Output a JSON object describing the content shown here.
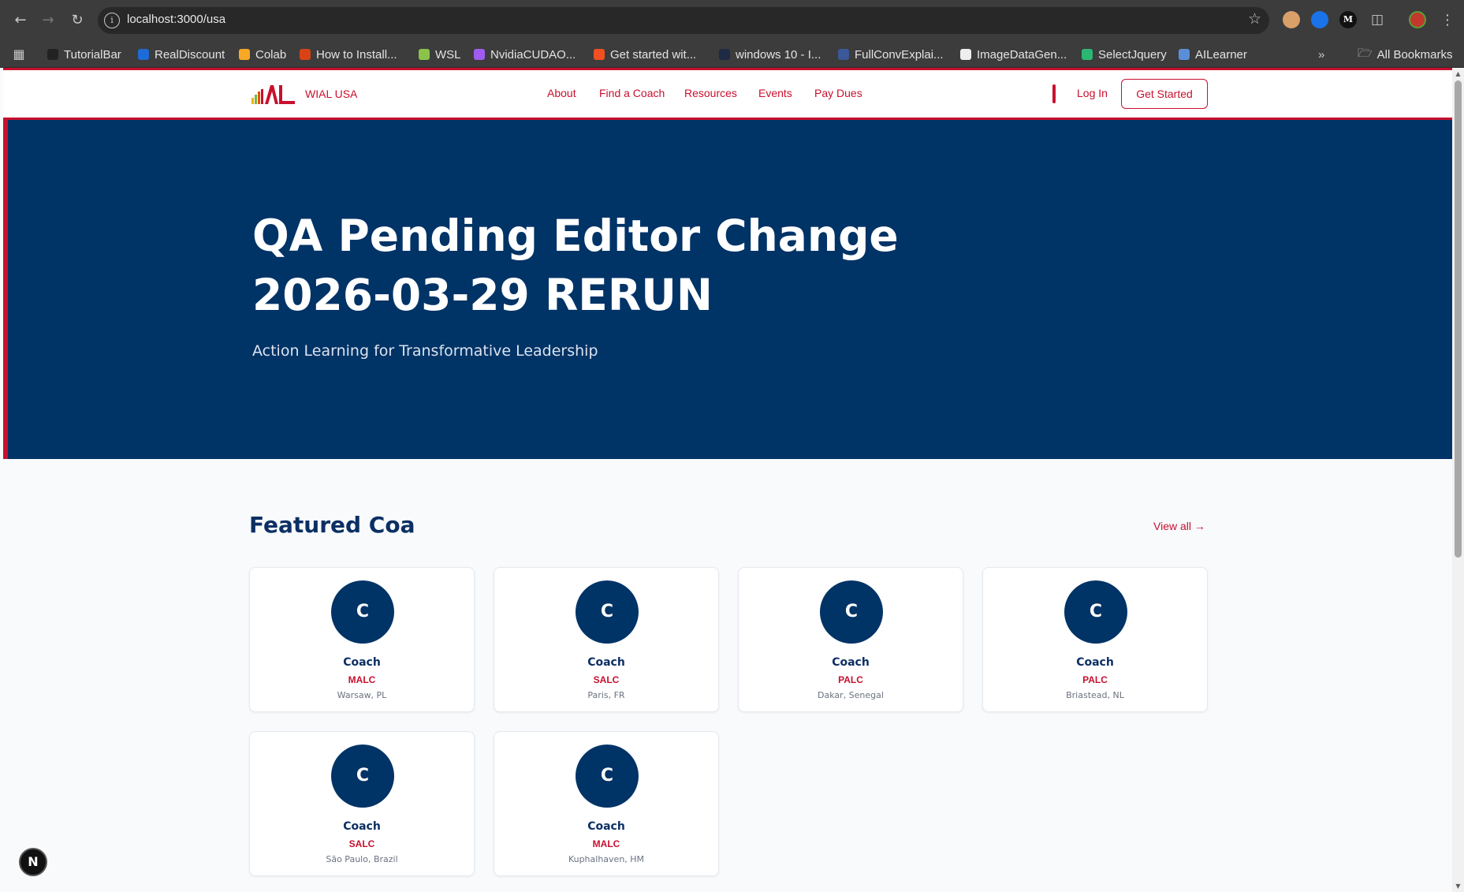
{
  "browser": {
    "url": "localhost:3000/usa",
    "bookmarks": [
      {
        "label": "TutorialBar",
        "color": "#222222"
      },
      {
        "label": "RealDiscount",
        "color": "#1e6ad6"
      },
      {
        "label": "Colab",
        "color": "#f9a825"
      },
      {
        "label": "How to Install...",
        "color": "#d84315"
      },
      {
        "label": "WSL",
        "color": "#8bc34a"
      },
      {
        "label": "NvidiaCUDAO...",
        "color": "#a05cf0"
      },
      {
        "label": "Get started wit...",
        "color": "#f25022"
      },
      {
        "label": "windows 10 - I...",
        "color": "#1f2a44"
      },
      {
        "label": "FullConvExplai...",
        "color": "#3b5998"
      },
      {
        "label": "ImageDataGen...",
        "color": "#eeeeee"
      },
      {
        "label": "SelectJquery",
        "color": "#2bb673"
      },
      {
        "label": "AILearner",
        "color": "#5a8fd8"
      }
    ],
    "all_bookmarks_label": "All Bookmarks"
  },
  "site": {
    "brand": "WIAL USA",
    "nav": [
      "About",
      "Find a Coach",
      "Resources",
      "Events",
      "Pay Dues"
    ],
    "login": "Log In",
    "cta": "Get Started"
  },
  "hero": {
    "title": "QA Pending Editor Change 2026-03-29 RERUN",
    "subtitle": "Action Learning for Transformative Leadership"
  },
  "featured": {
    "title": "Featured Coa",
    "view_all": "View all →",
    "coaches": [
      {
        "initial": "C",
        "name": "Coach",
        "cert": "MALC",
        "location": "Warsaw, PL"
      },
      {
        "initial": "C",
        "name": "Coach",
        "cert": "SALC",
        "location": "Paris, FR"
      },
      {
        "initial": "C",
        "name": "Coach",
        "cert": "PALC",
        "location": "Dakar, Senegal"
      },
      {
        "initial": "C",
        "name": "Coach",
        "cert": "PALC",
        "location": "Briastead, NL"
      },
      {
        "initial": "C",
        "name": "Coach",
        "cert": "SALC",
        "location": "São Paulo, Brazil"
      },
      {
        "initial": "C",
        "name": "Coach",
        "cert": "MALC",
        "location": "Kuphalhaven, HM"
      }
    ]
  },
  "dev_badge": "N",
  "colors": {
    "brand_red": "#c8102e",
    "navy": "#003366"
  }
}
